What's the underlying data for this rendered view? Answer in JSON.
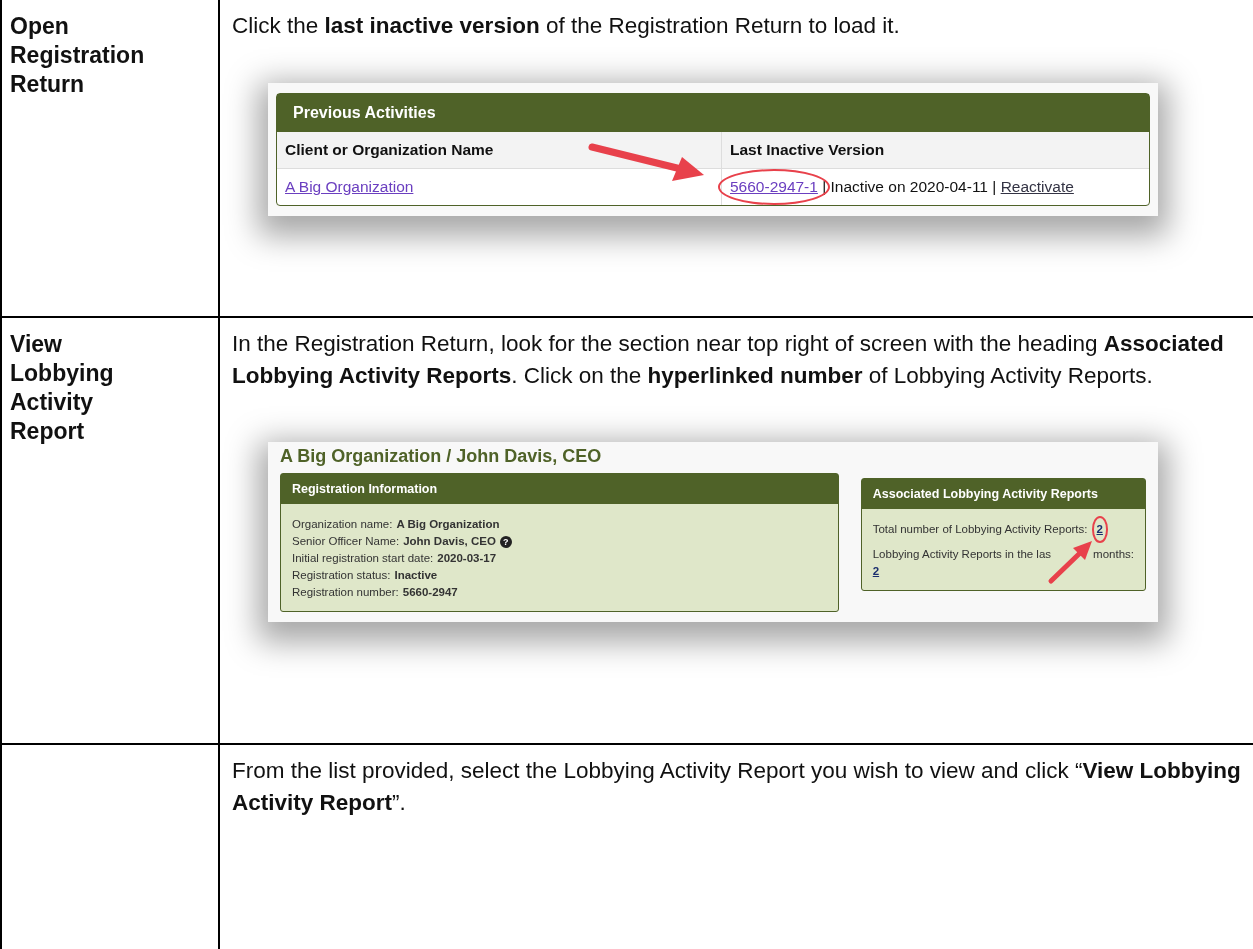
{
  "rows": [
    {
      "step": "Open Registration Return",
      "instruction": "Click the **last inactive version** of the Registration Return to load it.",
      "screenshot": {
        "kind": "activities",
        "title": "Previous Activities",
        "columns": [
          "Client or Organization Name",
          "Last Inactive Version"
        ],
        "org_link": "A Big Organization",
        "version_link": "5660-2947-1",
        "status": "| Inactive on 2020-04-11 |",
        "action_link": "Reactivate"
      }
    },
    {
      "step": "View Lobbying Activity Report",
      "instruction": "In the Registration Return, look for the section near top right of screen with the heading **Associated Lobbying Activity Reports**. Click on the **hyperlinked number** of  Lobbying Activity Reports.",
      "screenshot": {
        "kind": "registration",
        "heading": "A Big Organization / John Davis, CEO",
        "info_title": "Registration Information",
        "fields": [
          {
            "label": "Organization name:",
            "value": "A Big Organization"
          },
          {
            "label": "Senior Officer Name:",
            "value": "John Davis, CEO",
            "help_icon": "?"
          },
          {
            "label": "Initial registration start date:",
            "value": "2020-03-17"
          },
          {
            "label": "Registration status:",
            "value": "Inactive"
          },
          {
            "label": "Registration number:",
            "value": "5660-2947"
          }
        ],
        "reports_title": "Associated Lobbying Activity Reports",
        "total_label": "Total number of Lobbying Activity Reports:",
        "total_link": "2",
        "recent_label_start": "Lobbying Activity Reports in the las",
        "recent_label_end": "months:",
        "recent_link": "2"
      }
    },
    {
      "instruction": "From the list provided, select the Lobbying Activity Report you wish to view and click “**View Lobbying Activity Report**”."
    }
  ]
}
